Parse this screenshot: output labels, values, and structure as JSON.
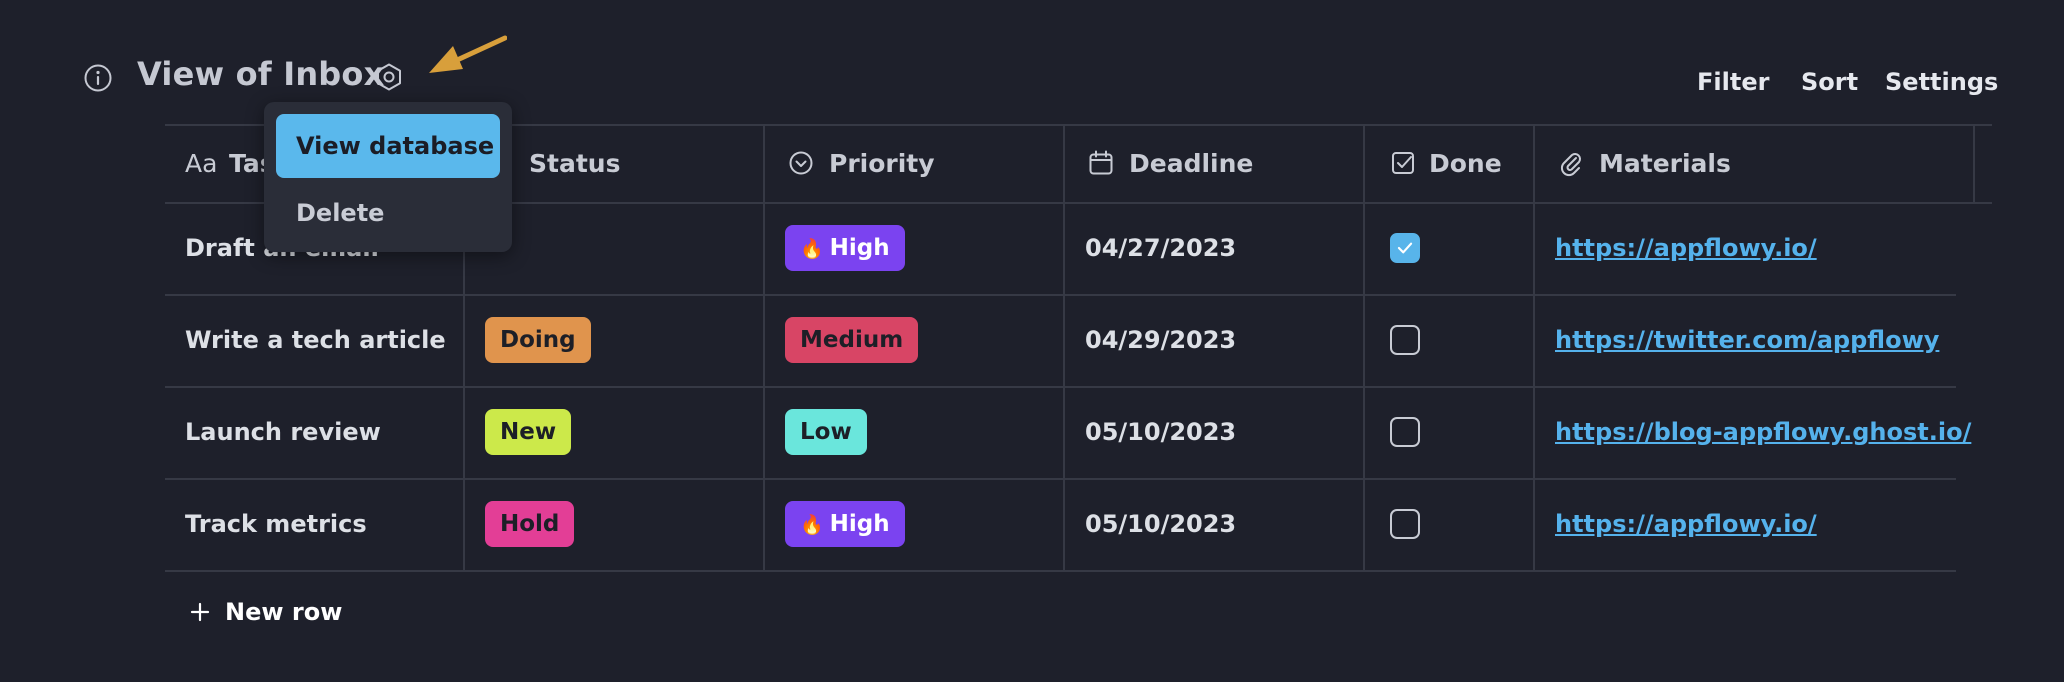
{
  "header": {
    "title": "View of Inbox",
    "info_icon": "info-icon",
    "settings_icon": "gear-hexagon-icon",
    "annotation_arrow_color": "#d89f3b"
  },
  "toolbar": {
    "filter_label": "Filter",
    "sort_label": "Sort",
    "settings_label": "Settings"
  },
  "popup_menu": {
    "items": [
      {
        "label": "View database",
        "highlighted": true
      },
      {
        "label": "Delete",
        "highlighted": false
      }
    ]
  },
  "table": {
    "columns": [
      {
        "label": "Task",
        "icon": "text-icon",
        "icon_text": "Aa"
      },
      {
        "label": "Status",
        "icon": "status-icon"
      },
      {
        "label": "Priority",
        "icon": "priority-icon"
      },
      {
        "label": "Deadline",
        "icon": "calendar-icon"
      },
      {
        "label": "Done",
        "icon": "checkbox-icon"
      },
      {
        "label": "Materials",
        "icon": "paperclip-icon"
      }
    ],
    "rows": [
      {
        "task": "Draft an email",
        "status": "",
        "priority": "High",
        "priority_emoji": "🔥",
        "deadline": "04/27/2023",
        "done": true,
        "materials": "https://appflowy.io/"
      },
      {
        "task": "Write a tech article",
        "status": "Doing",
        "priority": "Medium",
        "priority_emoji": "",
        "deadline": "04/29/2023",
        "done": false,
        "materials": "https://twitter.com/appflowy"
      },
      {
        "task": "Launch review",
        "status": "New",
        "priority": "Low",
        "priority_emoji": "",
        "deadline": "05/10/2023",
        "done": false,
        "materials": "https://blog-appflowy.ghost.io/"
      },
      {
        "task": "Track metrics",
        "status": "Hold",
        "priority": "High",
        "priority_emoji": "🔥",
        "deadline": "05/10/2023",
        "done": false,
        "materials": "https://appflowy.io/"
      }
    ],
    "new_row_label": "New row"
  },
  "colors": {
    "background": "#1e202b",
    "grid": "#363945",
    "link": "#55b2ec",
    "status_doing": "#e0944d",
    "status_new": "#cce94a",
    "status_hold": "#e33e96",
    "priority_high": "#7b43f0",
    "priority_medium": "#d84565",
    "priority_low": "#6ae6dc",
    "checkbox_checked": "#58b4ea",
    "menu_highlight": "#5ab8ec"
  }
}
